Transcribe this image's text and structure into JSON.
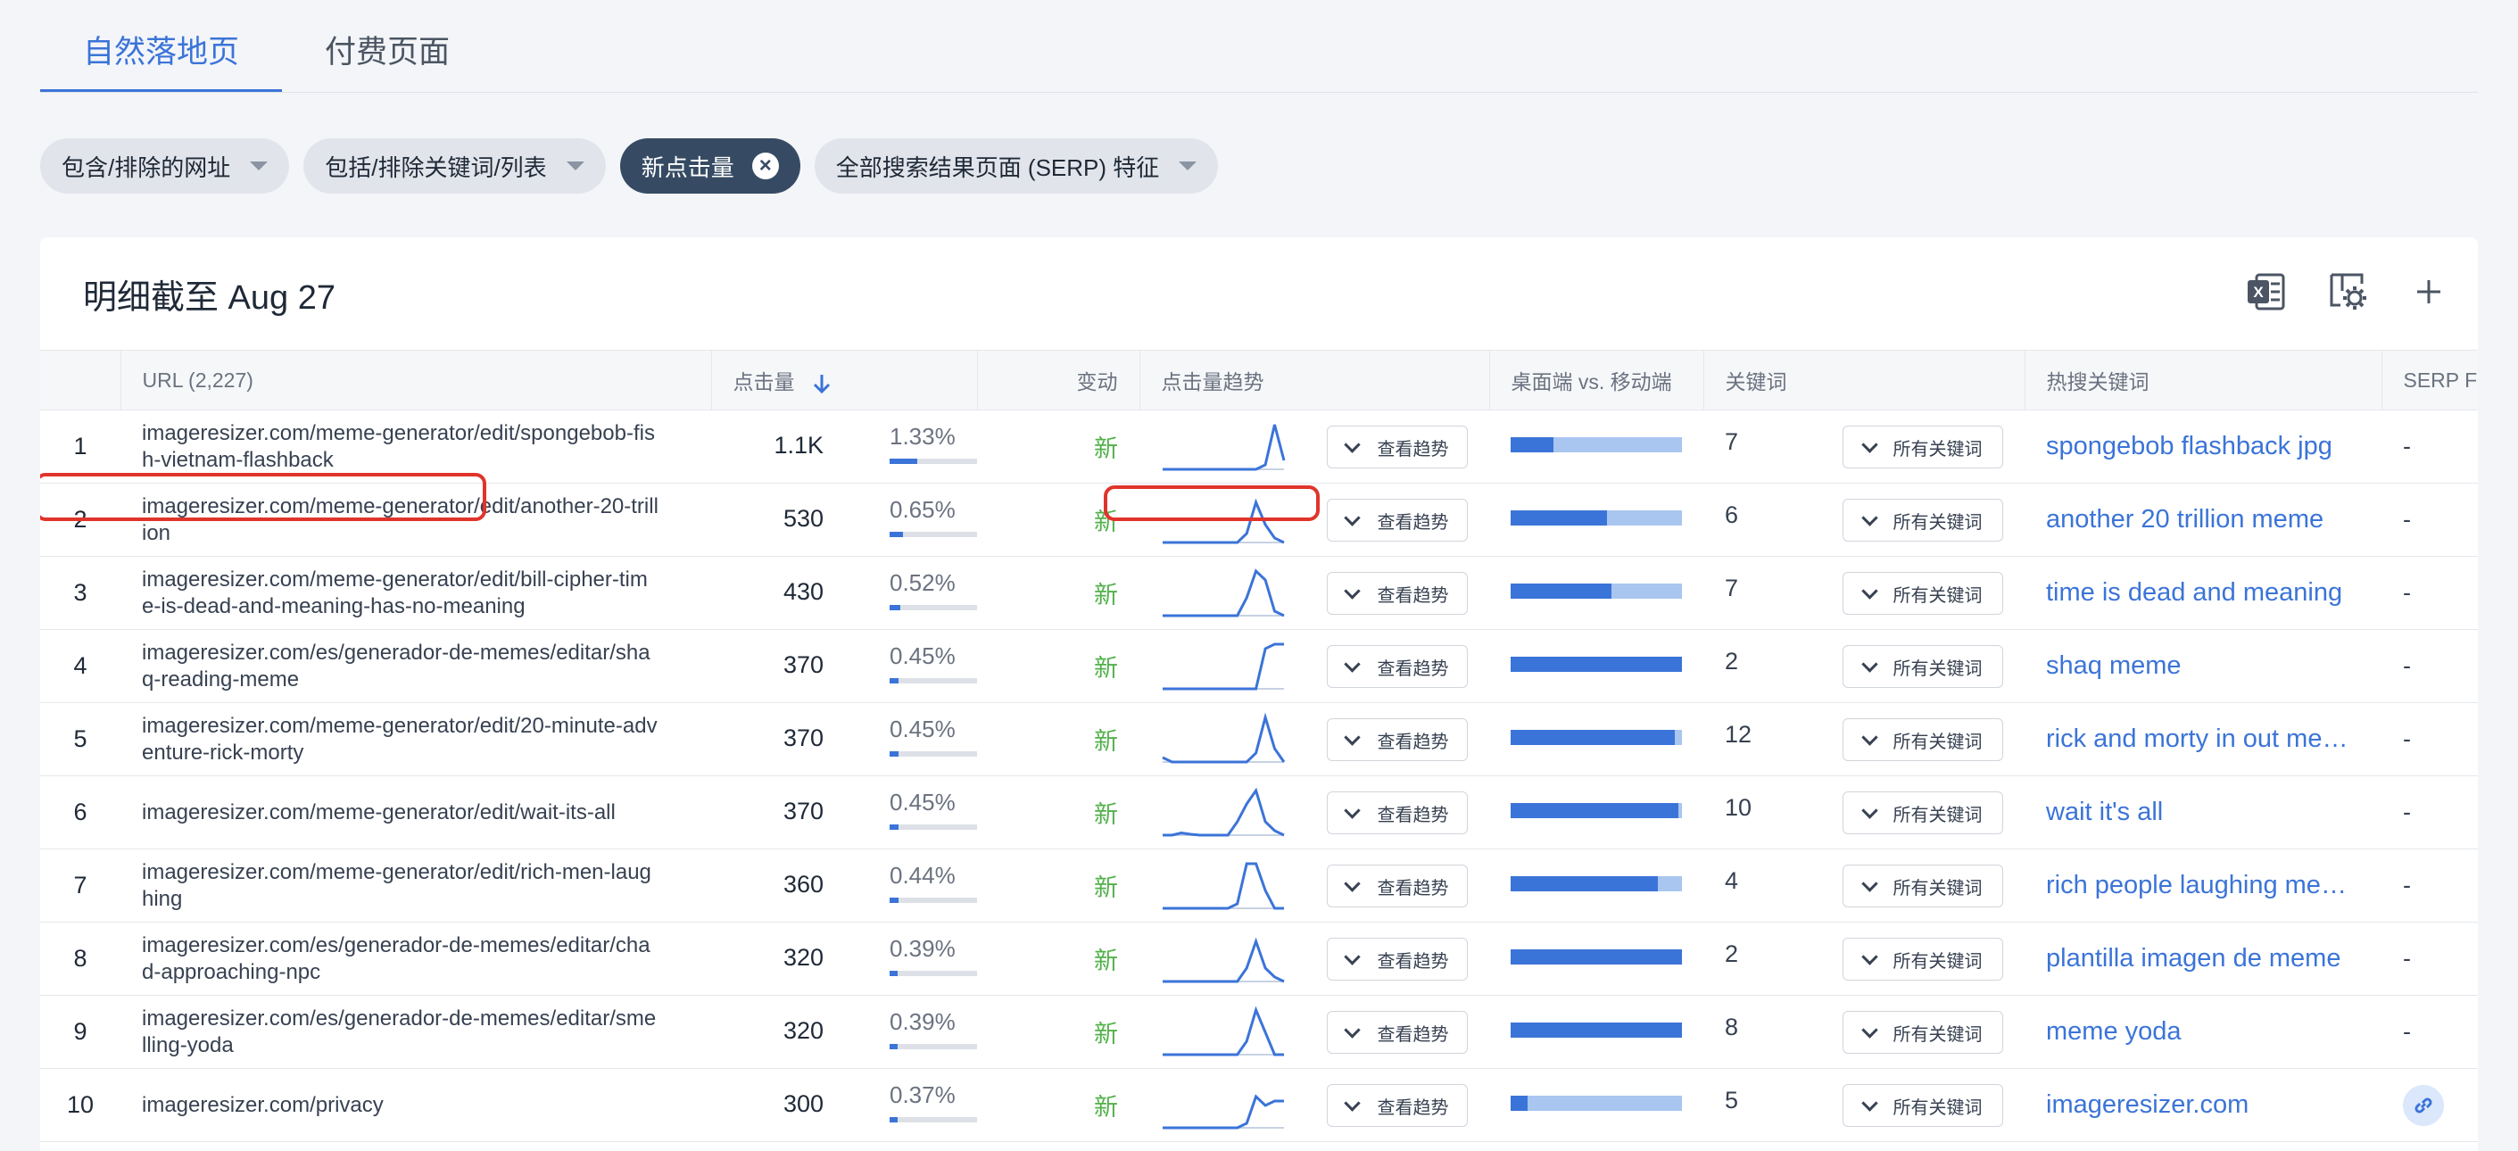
{
  "tabs": [
    {
      "label": "自然落地页",
      "active": true
    },
    {
      "label": "付费页面",
      "active": false
    }
  ],
  "filters": [
    {
      "label": "包含/排除的网址",
      "style": "dropdown"
    },
    {
      "label": "包括/排除关键词/列表",
      "style": "dropdown"
    },
    {
      "label": "新点击量",
      "style": "active-removable"
    },
    {
      "label": "全部搜索结果页面 (SERP) 特征",
      "style": "dropdown"
    }
  ],
  "card": {
    "title": "明细截至 Aug 27",
    "tools": [
      "excel-export-icon",
      "column-settings-icon",
      "add-icon"
    ]
  },
  "table": {
    "columns": {
      "url": "URL (2,227)",
      "clicks": "点击量",
      "change": "变动",
      "trend": "点击量趋势",
      "device": "桌面端 vs. 移动端",
      "keywords": "关键词",
      "top_keyword": "热搜关键词",
      "serp": "SERP Fe"
    },
    "trend_button": "查看趋势",
    "keywords_button": "所有关键词",
    "rows": [
      {
        "n": "1",
        "url": "imageresizer.com/meme-generator/edit/spongebob-fish-vietnam-flashback",
        "clicks": "1.1K",
        "pct": "1.33%",
        "pct_value": 1.33,
        "change": "新",
        "desktop_share": 0.25,
        "keywords": "7",
        "top": "spongebob flashback jpg",
        "serp": "-",
        "trend": [
          0,
          0,
          0,
          0,
          0,
          0,
          0,
          0,
          0,
          0,
          0,
          0.1,
          1,
          0.2
        ]
      },
      {
        "n": "2",
        "url": "imageresizer.com/meme-generator/edit/another-20-trillion",
        "clicks": "530",
        "pct": "0.65%",
        "pct_value": 0.65,
        "change": "新",
        "desktop_share": 0.56,
        "keywords": "6",
        "top": "another 20 trillion meme",
        "serp": "-",
        "trend": [
          0,
          0,
          0,
          0,
          0,
          0,
          0,
          0,
          0,
          0.2,
          0.9,
          0.4,
          0.1,
          0
        ]
      },
      {
        "n": "3",
        "url": "imageresizer.com/meme-generator/edit/bill-cipher-time-is-dead-and-meaning-has-no-meaning",
        "clicks": "430",
        "pct": "0.52%",
        "pct_value": 0.52,
        "change": "新",
        "desktop_share": 0.59,
        "keywords": "7",
        "top": "time is dead and meaning",
        "serp": "-",
        "trend": [
          0,
          0,
          0,
          0,
          0,
          0,
          0,
          0,
          0,
          0.4,
          1,
          0.8,
          0.1,
          0
        ]
      },
      {
        "n": "4",
        "url": "imageresizer.com/es/generador-de-memes/editar/shaq-reading-meme",
        "clicks": "370",
        "pct": "0.45%",
        "pct_value": 0.45,
        "change": "新",
        "desktop_share": 1.0,
        "keywords": "2",
        "top": "shaq meme",
        "serp": "-",
        "trend": [
          0,
          0,
          0,
          0,
          0,
          0,
          0,
          0,
          0,
          0,
          0,
          0.9,
          1,
          1
        ]
      },
      {
        "n": "5",
        "url": "imageresizer.com/meme-generator/edit/20-minute-adventure-rick-morty",
        "clicks": "370",
        "pct": "0.45%",
        "pct_value": 0.45,
        "change": "新",
        "desktop_share": 0.96,
        "keywords": "12",
        "top": "rick and morty in out meme",
        "serp": "-",
        "trend": [
          0.1,
          0,
          0,
          0,
          0,
          0,
          0,
          0,
          0,
          0,
          0.2,
          1,
          0.3,
          0
        ]
      },
      {
        "n": "6",
        "url": "imageresizer.com/meme-generator/edit/wait-its-all",
        "clicks": "370",
        "pct": "0.45%",
        "pct_value": 0.45,
        "change": "新",
        "desktop_share": 0.98,
        "keywords": "10",
        "top": "wait it's all",
        "serp": "-",
        "trend": [
          0,
          0,
          0.05,
          0.02,
          0,
          0,
          0,
          0,
          0.3,
          0.7,
          1,
          0.3,
          0.1,
          0
        ]
      },
      {
        "n": "7",
        "url": "imageresizer.com/meme-generator/edit/rich-men-laughing",
        "clicks": "360",
        "pct": "0.44%",
        "pct_value": 0.44,
        "change": "新",
        "desktop_share": 0.86,
        "keywords": "4",
        "top": "rich people laughing meme",
        "serp": "-",
        "trend": [
          0,
          0,
          0,
          0,
          0,
          0,
          0,
          0,
          0.1,
          1,
          1,
          0.4,
          0,
          0
        ]
      },
      {
        "n": "8",
        "url": "imageresizer.com/es/generador-de-memes/editar/chad-approaching-npc",
        "clicks": "320",
        "pct": "0.39%",
        "pct_value": 0.39,
        "change": "新",
        "desktop_share": 1.0,
        "keywords": "2",
        "top": "plantilla imagen de meme",
        "serp": "-",
        "trend": [
          0,
          0,
          0,
          0,
          0,
          0,
          0,
          0,
          0,
          0.3,
          0.9,
          0.3,
          0.1,
          0
        ]
      },
      {
        "n": "9",
        "url": "imageresizer.com/es/generador-de-memes/editar/smelling-yoda",
        "clicks": "320",
        "pct": "0.39%",
        "pct_value": 0.39,
        "change": "新",
        "desktop_share": 1.0,
        "keywords": "8",
        "top": "meme yoda",
        "serp": "-",
        "trend": [
          0,
          0,
          0,
          0,
          0,
          0,
          0,
          0,
          0,
          0.3,
          1,
          0.5,
          0,
          0
        ]
      },
      {
        "n": "10",
        "url": "imageresizer.com/privacy",
        "clicks": "300",
        "pct": "0.37%",
        "pct_value": 0.37,
        "change": "新",
        "desktop_share": 0.1,
        "keywords": "5",
        "top": "imageresizer.com",
        "serp": "link",
        "trend": [
          0,
          0,
          0,
          0,
          0,
          0,
          0,
          0,
          0,
          0.1,
          0.7,
          0.5,
          0.6,
          0.6
        ]
      }
    ]
  },
  "colors": {
    "accent": "#3b74d8",
    "new": "#52b04a",
    "highlight": "#e0342b",
    "mobile": "#a9c6f0"
  }
}
